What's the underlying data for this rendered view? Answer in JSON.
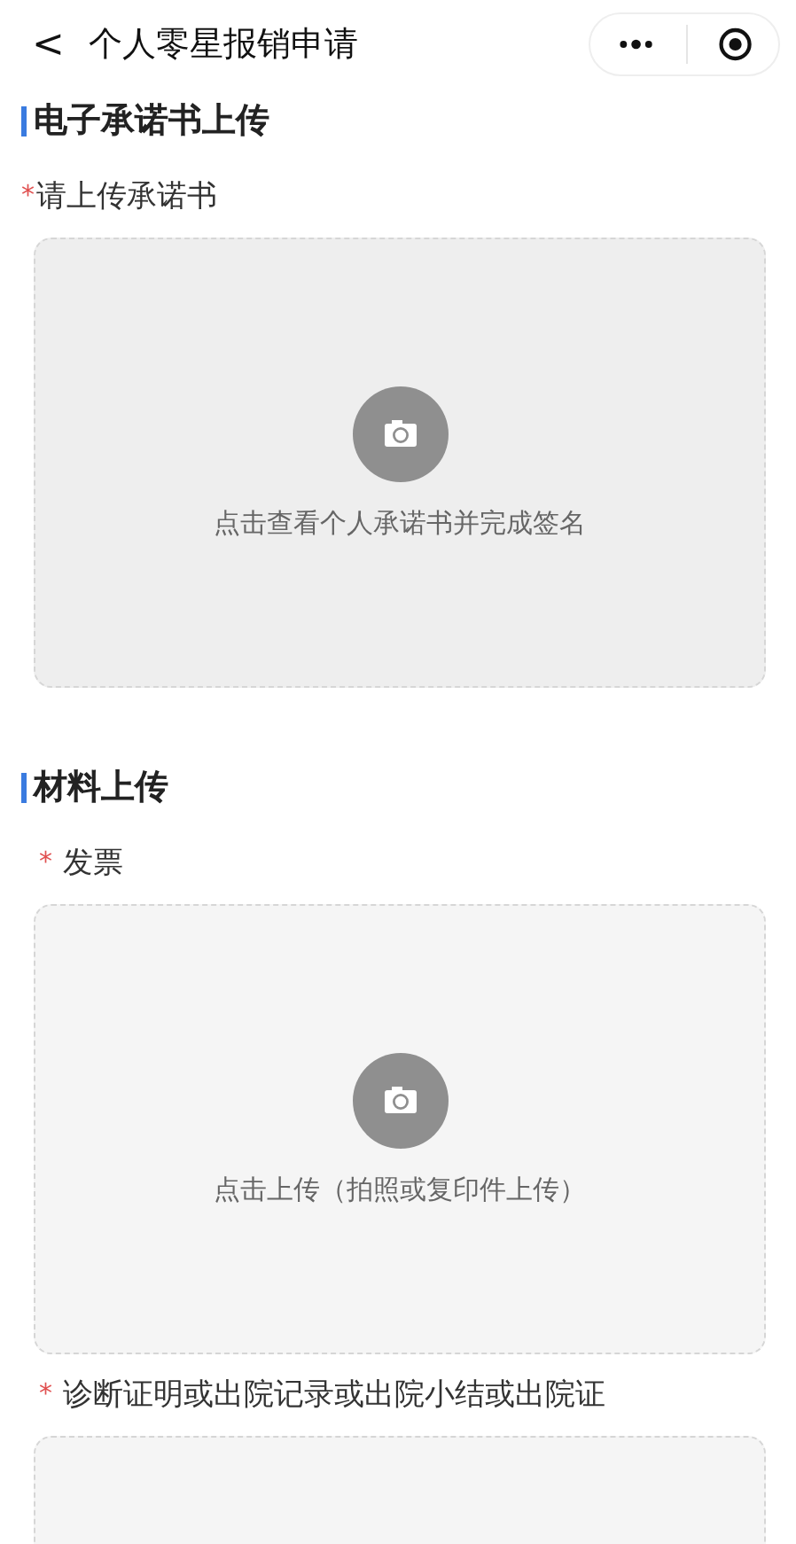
{
  "nav": {
    "back": "<",
    "title": "个人零星报销申请"
  },
  "sections": [
    {
      "title": "电子承诺书上传",
      "fields": [
        {
          "label": "请上传承诺书",
          "required_mark": "*",
          "hint": "点击查看个人承诺书并完成签名"
        }
      ]
    },
    {
      "title": "材料上传",
      "fields": [
        {
          "label": "发票",
          "required_mark": "*",
          "hint": "点击上传（拍照或复印件上传）"
        },
        {
          "label": "诊断证明或出院记录或出院小结或出院证",
          "required_mark": "*"
        }
      ]
    }
  ]
}
